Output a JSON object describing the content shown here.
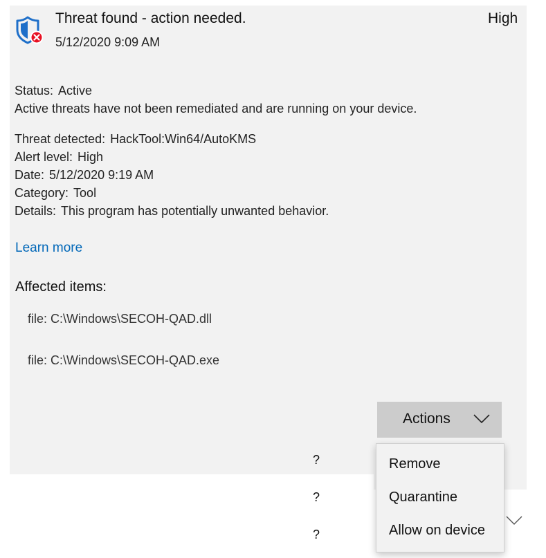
{
  "alert": {
    "title": "Threat found - action needed.",
    "severity": "High",
    "timestamp": "5/12/2020 9:09 AM"
  },
  "status": {
    "label": "Status:",
    "value": "Active",
    "description": "Active threats have not been remediated and are running on your device."
  },
  "details": [
    {
      "label": "Threat detected:",
      "value": "HackTool:Win64/AutoKMS"
    },
    {
      "label": "Alert level:",
      "value": "High"
    },
    {
      "label": "Date:",
      "value": "5/12/2020 9:19 AM"
    },
    {
      "label": "Category:",
      "value": "Tool"
    },
    {
      "label": "Details:",
      "value": "This program has potentially unwanted behavior."
    }
  ],
  "learn_more": "Learn more",
  "affected": {
    "heading": "Affected items:",
    "items": [
      "file: C:\\Windows\\SECOH-QAD.dll",
      "file: C:\\Windows\\SECOH-QAD.exe"
    ]
  },
  "actions": {
    "label": "Actions",
    "menu": [
      "Remove",
      "Quarantine",
      "Allow on device"
    ]
  },
  "background_marks": [
    "?",
    "?",
    "?"
  ],
  "colors": {
    "panel": "#f2f2f2",
    "button": "#cccccc",
    "link": "#0067b8",
    "shield": "#1e6fc9",
    "badge": "#e81123"
  },
  "icons": {
    "shield": "shield-icon",
    "badge": "error-badge-icon",
    "chevron": "chevron-down-icon"
  }
}
